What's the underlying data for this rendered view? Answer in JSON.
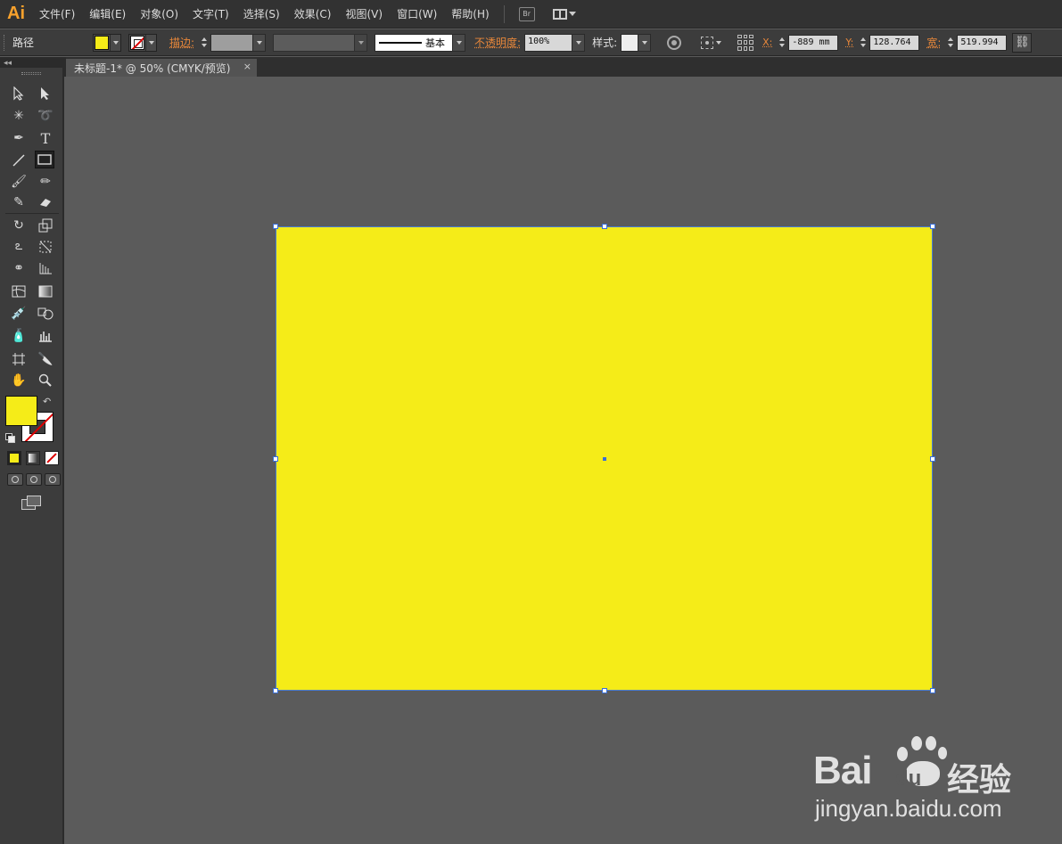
{
  "app": {
    "logo": "Ai"
  },
  "menu": {
    "items": [
      "文件(F)",
      "编辑(E)",
      "对象(O)",
      "文字(T)",
      "选择(S)",
      "效果(C)",
      "视图(V)",
      "窗口(W)",
      "帮助(H)"
    ],
    "bridge_label": "Br"
  },
  "control_bar": {
    "selection_label": "路径",
    "fill_color": "#f5ec18",
    "stroke_label": "描边:",
    "stroke_profile": "基本",
    "opacity_label": "不透明度:",
    "opacity_value": "100%",
    "style_label": "样式:",
    "x_label": "X:",
    "x_value": "-889 mm",
    "y_label": "Y:",
    "y_value": "128.764",
    "w_label": "宽:",
    "w_value": "519.994"
  },
  "document": {
    "tab_title": "未标题-1* @ 50% (CMYK/预览)",
    "close_glyph": "×"
  },
  "toolbox": {
    "fill_color": "#f5ec18",
    "active_tool": "rectangle-tool"
  },
  "canvas": {
    "background": "#5b5b5b",
    "shape_fill": "#f5ec18",
    "selection_color": "#3b6fd6"
  },
  "watermark": {
    "brand": "Bai",
    "brand_suffix": "du",
    "cn": "经验",
    "url": "jingyan.baidu.com"
  }
}
